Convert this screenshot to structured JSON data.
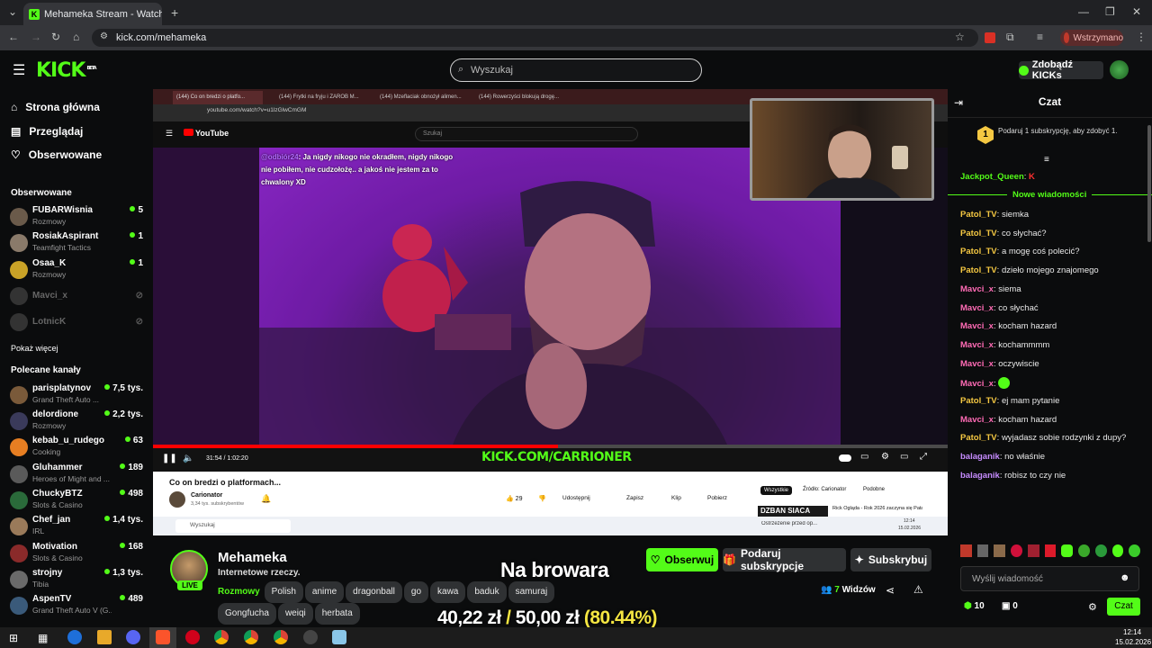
{
  "browser": {
    "tab_title": "Mehameka Stream - Watch",
    "url": "kick.com/mehameka",
    "paused_label": "Wstrzymano"
  },
  "header": {
    "logo": "KICK",
    "beta": "BETA",
    "search_placeholder": "Wyszukaj",
    "get_kicks": "Zdobądź KICKs"
  },
  "sidebar": {
    "nav": [
      {
        "label": "Strona główna",
        "icon": "home-icon"
      },
      {
        "label": "Przeglądaj",
        "icon": "browse-icon"
      },
      {
        "label": "Obserwowane",
        "icon": "heart-icon"
      }
    ],
    "followed_title": "Obserwowane",
    "followed": [
      {
        "name": "FUBARWisnia",
        "category": "Rozmowy",
        "viewers": "5",
        "live": true
      },
      {
        "name": "RosiakAspirant",
        "category": "Teamfight Tactics",
        "viewers": "1",
        "live": true
      },
      {
        "name": "Osaa_K",
        "category": "Rozmowy",
        "viewers": "1",
        "live": true
      },
      {
        "name": "Mavci_x",
        "category": "",
        "viewers": "",
        "live": false
      },
      {
        "name": "LotnicK",
        "category": "",
        "viewers": "",
        "live": false
      }
    ],
    "show_more": "Pokaż więcej",
    "recommended_title": "Polecane kanały",
    "recommended": [
      {
        "name": "parisplatynov",
        "category": "Grand Theft Auto ...",
        "viewers": "7,5 tys."
      },
      {
        "name": "delordione",
        "category": "Rozmowy",
        "viewers": "2,2 tys."
      },
      {
        "name": "kebab_u_rudego",
        "category": "Cooking",
        "viewers": "63"
      },
      {
        "name": "Gluhammer",
        "category": "Heroes of Might and ...",
        "viewers": "189"
      },
      {
        "name": "ChuckyBTZ",
        "category": "Slots & Casino",
        "viewers": "498"
      },
      {
        "name": "Chef_jan",
        "category": "IRL",
        "viewers": "1,4 tys."
      },
      {
        "name": "Motivation",
        "category": "Slots & Casino",
        "viewers": "168"
      },
      {
        "name": "strojny",
        "category": "Tibia",
        "viewers": "1,3 tys."
      },
      {
        "name": "AspenTV",
        "category": "Grand Theft Auto V (G...",
        "viewers": "489"
      }
    ]
  },
  "video": {
    "inner_tabs": [
      "(144) Co on bredzi o platfo...",
      "(144) Frytki na fryju i ZAROB M...",
      "(144) Mzeflaciak obnożył alimen...",
      "(144) Rowerzyści blokują drogę..."
    ],
    "inner_url": "youtube.com/watch?v=u1lzGlwCmGM",
    "yt_logo": "YouTube",
    "yt_search": "Szukaj",
    "caption": ": Ja nigdy nikogo nie okradłem, nigdy nikogo nie pobiłem, nie cudzołożę.. a jakoś nie jestem za to chwalony XD",
    "caption_user": "@odbiór24",
    "time": "31:54 / 1:02:20",
    "progress": 0.51,
    "watermark": "KICK.COM/CARRIONER",
    "yt_title": "Co on bredzi o platformach...",
    "yt_channel": "Carionator",
    "yt_subs": "3,34 tys. subskrybentów",
    "yt_likes": "29",
    "yt_share": "Udostępnij",
    "yt_save": "Zapisz",
    "yt_clip": "Klip",
    "yt_download": "Pobierz",
    "yt_chips": [
      "Wszystkie",
      "Źródło: Carionator",
      "Podobne"
    ],
    "yt_side_thumb": "DZBAN SIACA",
    "yt_side_title": "Rick Ogląda - Rok 2026 zaczyna się Patalnią",
    "yt_notif": "Ostrzeżenie przed op...",
    "yt_search_task": "Wyszukaj",
    "yt_clock": "12:14",
    "yt_date": "15.02.2026"
  },
  "stream": {
    "streamer": "Mehameka",
    "title": "Internetowe rzeczy.",
    "category": "Rozmowy",
    "tags": [
      "Polish",
      "anime",
      "dragonball",
      "go",
      "kawa",
      "baduk",
      "samuraj",
      "Gongfucha",
      "weiqi",
      "herbata"
    ],
    "live": "LIVE",
    "overlay_title": "Na browara",
    "goal_current": "40,22 zł",
    "goal_sep": "/",
    "goal_target": "50,00 zł",
    "goal_pct": "(80.44%)",
    "follow": "Obserwuj",
    "gift": "Podaruj subskrypcje",
    "subscribe": "Subskrybuj",
    "viewers_count": "7",
    "viewers_label": "Widzów"
  },
  "chat": {
    "title": "Czat",
    "gift_prompt": "Podaruj 1 subskrypcję, aby zdobyć 1.",
    "gift_badge": "1",
    "new_messages": "Nowe wiadomości",
    "first": {
      "user": "Jackpot_Queen",
      "color": "#53fc18"
    },
    "messages": [
      {
        "user": "Patol_TV",
        "text": "siemka",
        "color": "#f5c842"
      },
      {
        "user": "Patol_TV",
        "text": "co słychać?",
        "color": "#f5c842"
      },
      {
        "user": "Patol_TV",
        "text": "a mogę coś polecić?",
        "color": "#f5c842"
      },
      {
        "user": "Patol_TV",
        "text": "dzieło mojego znajomego",
        "color": "#f5c842"
      },
      {
        "user": "Mavci_x",
        "text": "siema",
        "color": "#ff6bb5"
      },
      {
        "user": "Mavci_x",
        "text": "co słychać",
        "color": "#ff6bb5"
      },
      {
        "user": "Mavci_x",
        "text": "kocham hazard",
        "color": "#ff6bb5"
      },
      {
        "user": "Mavci_x",
        "text": "kochammmm",
        "color": "#ff6bb5"
      },
      {
        "user": "Mavci_x",
        "text": "oczywiscie",
        "color": "#ff6bb5"
      },
      {
        "user": "Mavci_x",
        "text": "",
        "color": "#ff6bb5"
      },
      {
        "user": "Patol_TV",
        "text": "ej mam pytanie",
        "color": "#f5c842"
      },
      {
        "user": "Mavci_x",
        "text": "kocham hazard",
        "color": "#ff6bb5"
      },
      {
        "user": "Patol_TV",
        "text": "wyjadasz sobie rodzynki z dupy?",
        "color": "#f5c842"
      },
      {
        "user": "balaganik",
        "text": "no właśnie",
        "color": "#c68cff"
      },
      {
        "user": "balaganik",
        "text": "robisz to czy nie",
        "color": "#c68cff"
      }
    ],
    "input_placeholder": "Wyślij wiadomość",
    "kicks": "10",
    "chests": "0",
    "send": "Czat"
  },
  "taskbar": {
    "time": "12:14",
    "date": "15.02.2026"
  },
  "colors": {
    "accent": "#53fc18",
    "bg": "#0b0c0d",
    "goal_pct": "#f5e642"
  }
}
